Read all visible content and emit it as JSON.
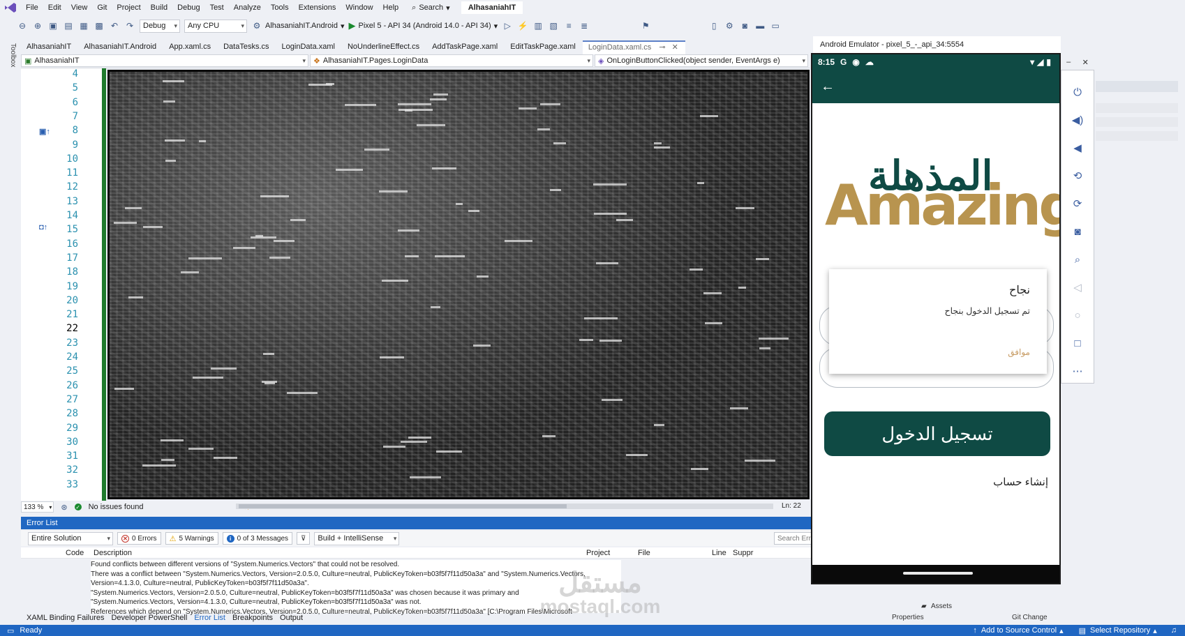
{
  "menubar": {
    "items": [
      "File",
      "Edit",
      "View",
      "Git",
      "Project",
      "Build",
      "Debug",
      "Test",
      "Analyze",
      "Tools",
      "Extensions",
      "Window",
      "Help"
    ],
    "search_label": "Search",
    "project_name": "AlhasaniahIT"
  },
  "toolbar": {
    "config": "Debug",
    "platform": "Any CPU",
    "startup_project": "AlhasaniahIT.Android",
    "device": "Pixel 5 - API 34 (Android 14.0 - API 34)"
  },
  "tabs": [
    {
      "label": "AlhasaniahIT",
      "active": false
    },
    {
      "label": "AlhasaniahIT.Android",
      "active": false
    },
    {
      "label": "App.xaml.cs",
      "active": false
    },
    {
      "label": "DataTesks.cs",
      "active": false
    },
    {
      "label": "LoginData.xaml",
      "active": false
    },
    {
      "label": "NoUnderlineEffect.cs",
      "active": false
    },
    {
      "label": "AddTaskPage.xaml",
      "active": false
    },
    {
      "label": "EditTaskPage.xaml",
      "active": false
    },
    {
      "label": "LoginData.xaml.cs",
      "active": true
    }
  ],
  "navbar": {
    "project": "AlhasaniahIT",
    "class": "AlhasaniahIT.Pages.LoginData",
    "member": "OnLoginButtonClicked(object sender, EventArgs e)"
  },
  "toolbox_label": "Toolbox",
  "editor": {
    "line_numbers": [
      "4",
      "5",
      "6",
      "7",
      "8",
      "9",
      "10",
      "11",
      "12",
      "13",
      "14",
      "15",
      "16",
      "17",
      "18",
      "19",
      "20",
      "21",
      "22",
      "23",
      "24",
      "25",
      "26",
      "27",
      "28",
      "29",
      "30",
      "31",
      "32",
      "33"
    ],
    "current_line": "22"
  },
  "status": {
    "zoom": "133 %",
    "issues": "No issues found",
    "position": "Ln: 22"
  },
  "error_list": {
    "title": "Error List",
    "scope": "Entire Solution",
    "errors": "0 Errors",
    "warnings": "5 Warnings",
    "messages": "0 of 3 Messages",
    "source": "Build + IntelliSense",
    "search_placeholder": "Search Error List",
    "columns": [
      "Code",
      "Description",
      "Project",
      "File",
      "Line",
      "Suppr"
    ],
    "lines": [
      "Found conflicts between different versions of \"System.Numerics.Vectors\" that could not be resolved.",
      "There was a conflict between \"System.Numerics.Vectors, Version=2.0.5.0, Culture=neutral, PublicKeyToken=b03f5f7f11d50a3a\" and \"System.Numerics.Vectors,",
      "Version=4.1.3.0, Culture=neutral, PublicKeyToken=b03f5f7f11d50a3a\".",
      "    \"System.Numerics.Vectors, Version=2.0.5.0, Culture=neutral, PublicKeyToken=b03f5f7f11d50a3a\" was chosen because it was primary and",
      "\"System.Numerics.Vectors, Version=4.1.3.0, Culture=neutral, PublicKeyToken=b03f5f7f11d50a3a\" was not.",
      "    References which depend on \"System.Numerics.Vectors, Version=2.0.5.0, Culture=neutral, PublicKeyToken=b03f5f7f11d50a3a\" [C:\\Program Files\\Microsoft"
    ]
  },
  "bottom_tabs": [
    {
      "label": "XAML Binding Failures",
      "active": false
    },
    {
      "label": "Developer PowerShell",
      "active": false
    },
    {
      "label": "Error List",
      "active": true
    },
    {
      "label": "Breakpoints",
      "active": false
    },
    {
      "label": "Output",
      "active": false
    }
  ],
  "watermark": {
    "ar": "مستقل",
    "en": "mostaql.com"
  },
  "statusbar": {
    "ready": "Ready",
    "source_control": "Add to Source Control",
    "repository": "Select Repository"
  },
  "emulator": {
    "title": "Android Emulator - pixel_5_-_api_34:5554",
    "time": "8:15",
    "logo_ar": "المذهلة",
    "logo_en": "Amazing",
    "dialog_title": "نجاح",
    "dialog_message": "تم تسجيل الدخول بنجاح",
    "dialog_ok": "موافق",
    "login_button": "تسجيل الدخول",
    "create_account": "إنشاء حساب"
  },
  "solution_explorer": {
    "assets": "Assets",
    "properties": "Properties",
    "git_changes": "Git Change"
  },
  "colors": {
    "accent": "#1f66c2",
    "app_primary": "#0f4a44",
    "brand_gold": "#b8944f"
  }
}
